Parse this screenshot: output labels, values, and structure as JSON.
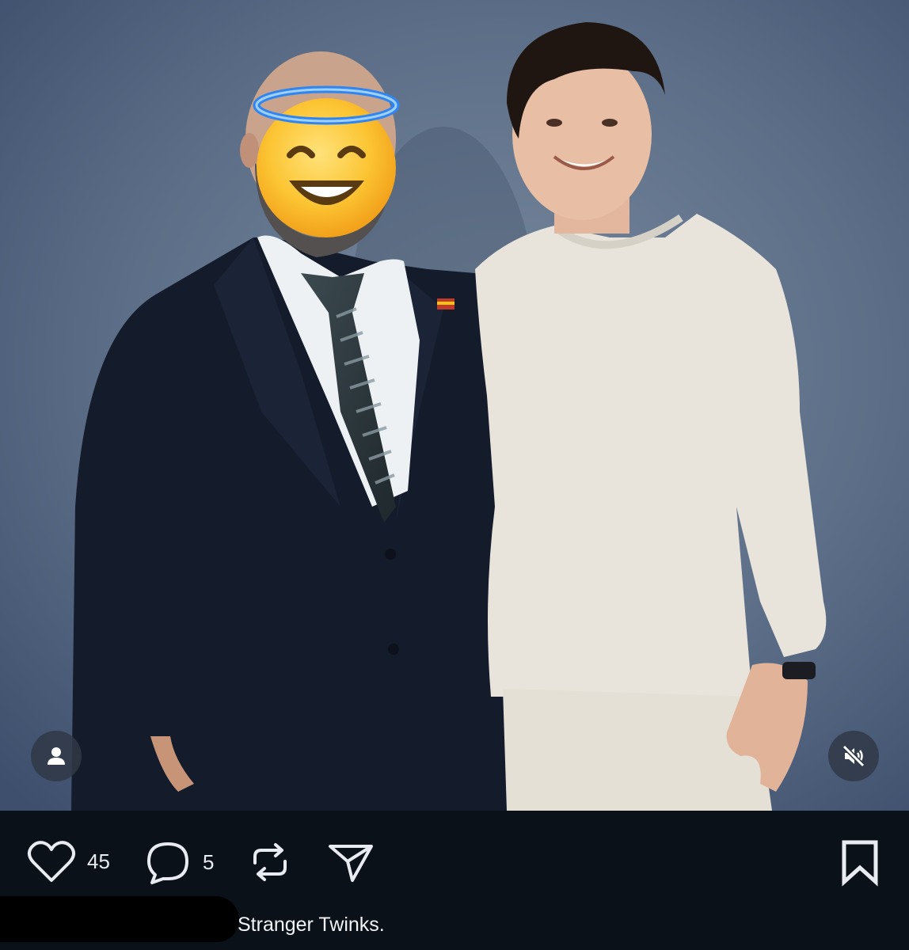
{
  "post": {
    "caption": "Stranger Twinks.",
    "redaction_color": "#000000"
  },
  "actions": {
    "like_count": "45",
    "comment_count": "5",
    "like_icon": "heart-icon",
    "comment_icon": "comment-bubble-icon",
    "repost_icon": "repost-icon",
    "share_icon": "paper-plane-icon",
    "save_icon": "bookmark-icon"
  },
  "overlay": {
    "profile_icon": "person-icon",
    "mute_icon": "speaker-muted-icon"
  },
  "photo": {
    "face_emoji_icon": "smiling-face-with-halo-emoji",
    "background_color": "#5b6d86"
  },
  "colors": {
    "app_background": "#0b1118",
    "icon_color": "#e8ecf2",
    "overlay_button_bg": "#303846"
  }
}
